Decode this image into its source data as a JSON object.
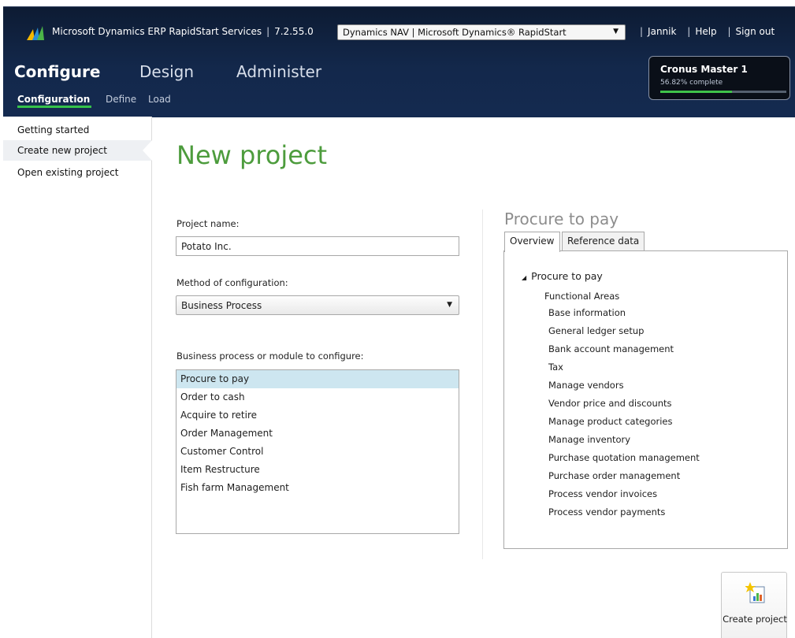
{
  "header": {
    "app_name": "Microsoft Dynamics ERP RapidStart Services",
    "separator": "|",
    "version": "7.2.55.0",
    "tenant": "Dynamics NAV | Microsoft Dynamics® RapidStart",
    "user": "Jannik",
    "help": "Help",
    "sign_out": "Sign out",
    "main_tabs": [
      "Configure",
      "Design",
      "Administer"
    ],
    "sub_tabs": [
      "Configuration",
      "Define",
      "Load"
    ]
  },
  "project_status": {
    "name": "Cronus Master 1",
    "progress_text": "56.82% complete",
    "progress": 56.82
  },
  "left_nav": [
    "Getting started",
    "Create new project",
    "Open existing project"
  ],
  "main": {
    "title": "New project",
    "project_name_label": "Project name:",
    "project_name_value": "Potato Inc.",
    "method_label": "Method of configuration:",
    "method_value": "Business Process",
    "process_label": "Business process or module to configure:",
    "processes": [
      "Procure to pay",
      "Order to cash",
      "Acquire to retire",
      "Order Management",
      "Customer Control",
      "Item Restructure",
      "Fish farm Management"
    ]
  },
  "detail": {
    "title": "Procure to pay",
    "tabs": [
      "Overview",
      "Reference data"
    ],
    "tree_root": "Procure to pay",
    "tree_sub": "Functional Areas",
    "tree_items": [
      "Base information",
      "General ledger setup",
      "Bank account management",
      "Tax",
      "Manage vendors",
      "Vendor price and discounts",
      "Manage product categories",
      "Manage inventory",
      "Purchase quotation management",
      "Purchase order management",
      "Process vendor invoices",
      "Process vendor payments"
    ]
  },
  "actions": {
    "create_project": "Create project"
  },
  "colors": {
    "header_bg": "#13284b",
    "accent_green": "#4d9c3d",
    "progress_green": "#3fc34a",
    "selection": "#cde6f0"
  }
}
